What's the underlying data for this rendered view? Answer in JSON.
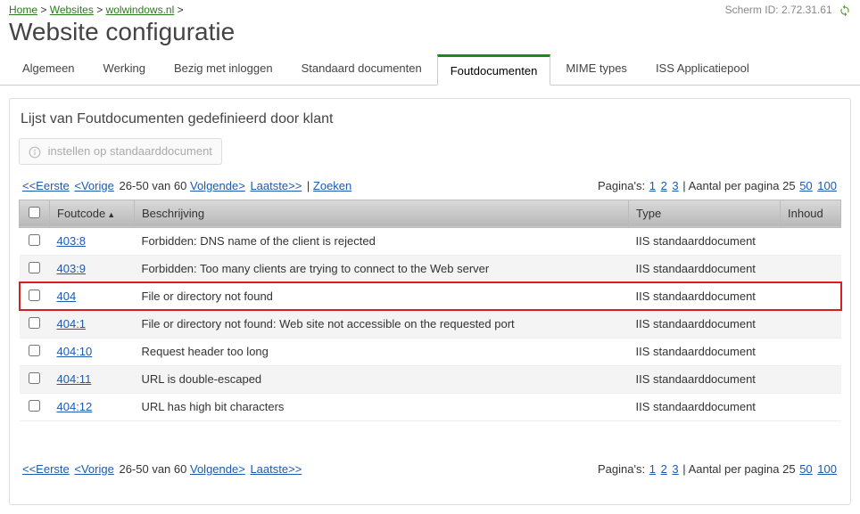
{
  "breadcrumb": [
    "Home",
    "Websites",
    "wolwindows.nl"
  ],
  "scherm_label": "Scherm ID:",
  "scherm_id": "2.72.31.61",
  "page_title": "Website configuratie",
  "tabs": [
    "Algemeen",
    "Werking",
    "Bezig met inloggen",
    "Standaard documenten",
    "Foutdocumenten",
    "MIME types",
    "ISS Applicatiepool"
  ],
  "panel_title": "Lijst van Foutdocumenten gedefinieerd door klant",
  "btn_default": "instellen op standaarddocument",
  "pager": {
    "first": "<<Eerste",
    "prev": "<Vorige",
    "range": "26-50 van 60",
    "next": "Volgende>",
    "last": "Laatste>>",
    "search": "Zoeken",
    "pages_label": "Pagina's:",
    "pages": [
      "1",
      "2",
      "3"
    ],
    "perpage_label": "Aantal per pagina",
    "perpage": [
      "25",
      "50",
      "100"
    ]
  },
  "columns": {
    "code": "Foutcode",
    "desc": "Beschrijving",
    "type": "Type",
    "content": "Inhoud"
  },
  "rows": [
    {
      "code": "403:8",
      "desc": "Forbidden: DNS name of the client is rejected",
      "type": "IIS standaarddocument",
      "hi": false,
      "alt": false
    },
    {
      "code": "403:9",
      "desc": "Forbidden: Too many clients are trying to connect to the Web server",
      "type": "IIS standaarddocument",
      "hi": false,
      "alt": true
    },
    {
      "code": "404",
      "desc": "File or directory not found",
      "type": "IIS standaarddocument",
      "hi": true,
      "alt": false
    },
    {
      "code": "404:1",
      "desc": "File or directory not found: Web site not accessible on the requested port",
      "type": "IIS standaarddocument",
      "hi": false,
      "alt": true
    },
    {
      "code": "404:10",
      "desc": "Request header too long",
      "type": "IIS standaarddocument",
      "hi": false,
      "alt": false
    },
    {
      "code": "404:11",
      "desc": "URL is double-escaped",
      "type": "IIS standaarddocument",
      "hi": false,
      "alt": true
    },
    {
      "code": "404:12",
      "desc": "URL has high bit characters",
      "type": "IIS standaarddocument",
      "hi": false,
      "alt": false
    }
  ]
}
